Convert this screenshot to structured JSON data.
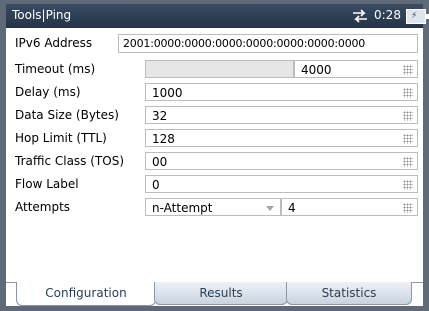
{
  "window": {
    "title": "Tools|Ping",
    "time": "0:28",
    "network_icon": "network-arrows-icon",
    "battery_icon": "battery-icon"
  },
  "form": {
    "ipv6_label": "IPv6 Address",
    "ipv6_value": "2001:0000:0000:0000:0000:0000:0000:0000",
    "timeout_label": "Timeout (ms)",
    "timeout_value": "4000",
    "delay_label": "Delay (ms)",
    "delay_value": "1000",
    "data_size_label": "Data Size (Bytes)",
    "data_size_value": "32",
    "hop_limit_label": "Hop Limit (TTL)",
    "hop_limit_value": "128",
    "traffic_class_label": "Traffic Class (TOS)",
    "traffic_class_value": "00",
    "flow_label_label": "Flow Label",
    "flow_label_value": "0",
    "attempts_label": "Attempts",
    "attempts_mode": "n-Attempt",
    "attempts_value": "4"
  },
  "tabs": [
    {
      "label": "Configuration",
      "active": true
    },
    {
      "label": "Results",
      "active": false
    },
    {
      "label": "Statistics",
      "active": false
    }
  ],
  "colors": {
    "titlebar": "#243347",
    "frame": "#5e6a77",
    "tab_text": "#2a3f57"
  }
}
